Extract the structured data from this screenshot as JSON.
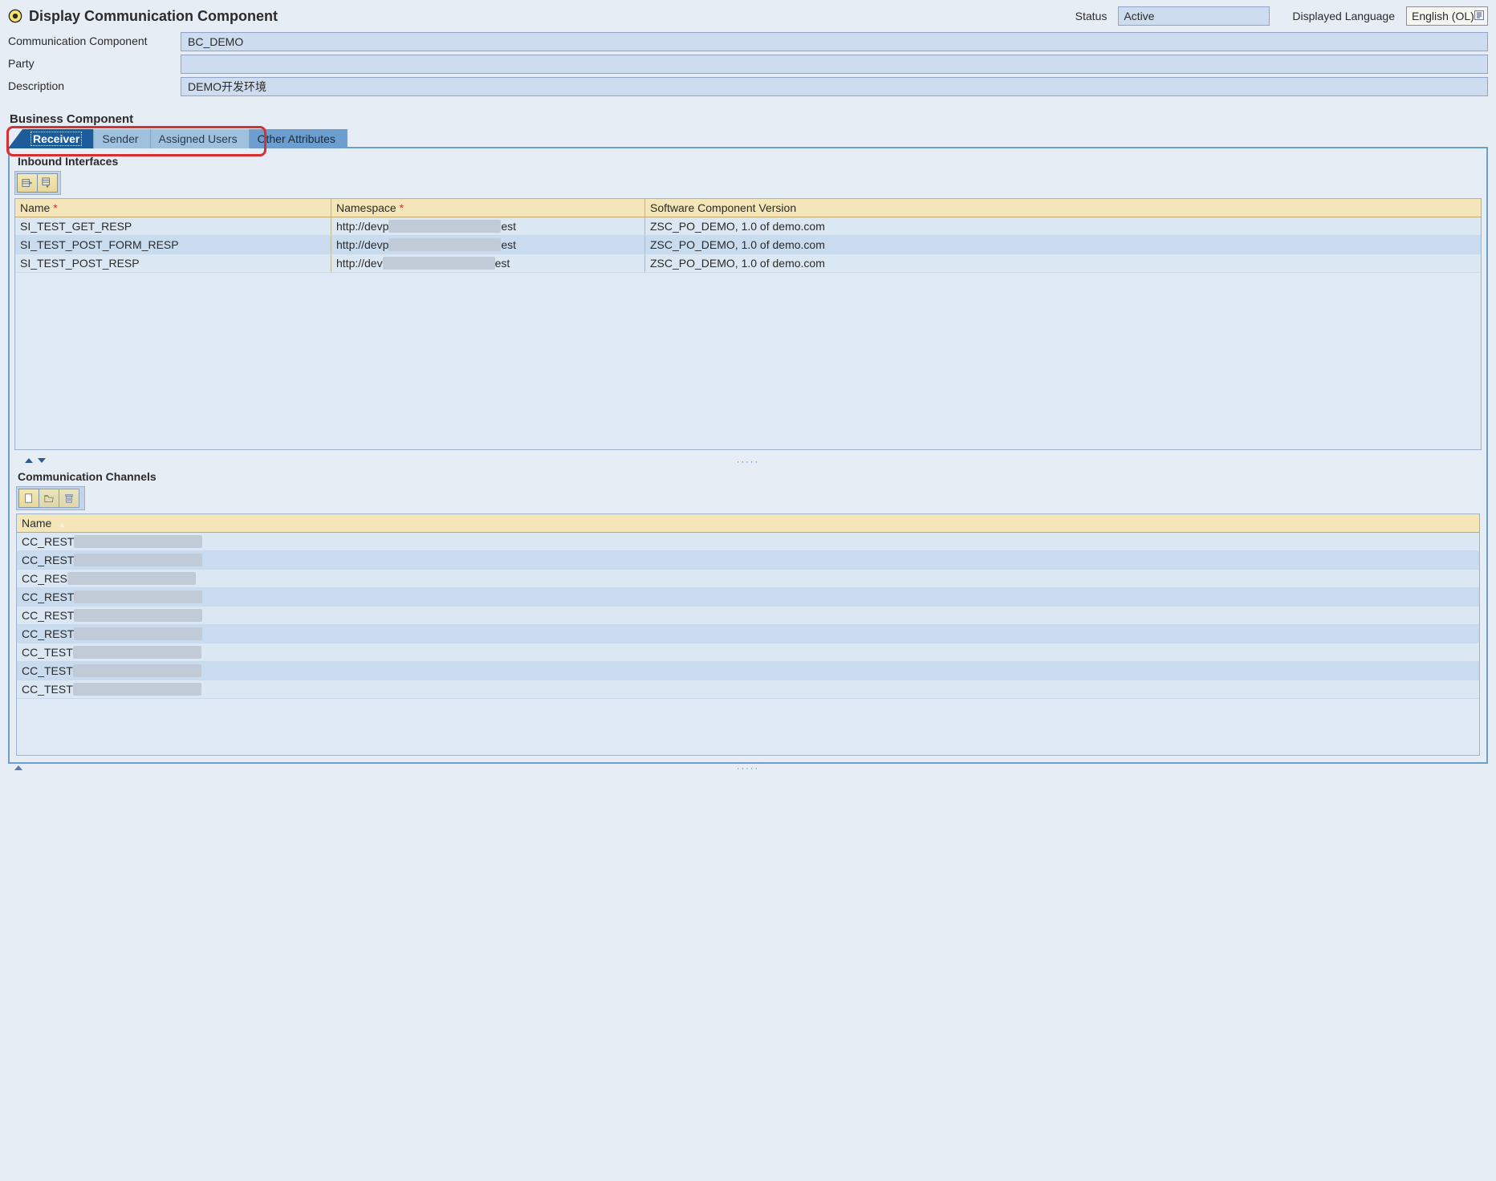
{
  "header": {
    "title": "Display Communication Component",
    "status_label": "Status",
    "status_value": "Active",
    "lang_label": "Displayed Language",
    "lang_value": "English (OL)"
  },
  "form": {
    "comm_comp_label": "Communication Component",
    "comm_comp_value": "BC_DEMO",
    "party_label": "Party",
    "party_value": "",
    "description_label": "Description",
    "description_value": "DEMO开发环境"
  },
  "section_heading": "Business Component",
  "tabs": {
    "receiver": "Receiver",
    "sender": "Sender",
    "assigned_users": "Assigned Users",
    "other_attributes": "Other Attributes"
  },
  "inbound": {
    "heading": "Inbound Interfaces",
    "col_name": "Name",
    "col_namespace": "Namespace",
    "col_scv": "Software Component Version",
    "rows": [
      {
        "name": "SI_TEST_GET_RESP",
        "ns_pre": "http://devp",
        "ns_suf": "est",
        "scv": "ZSC_PO_DEMO, 1.0 of demo.com"
      },
      {
        "name": "SI_TEST_POST_FORM_RESP",
        "ns_pre": "http://devp",
        "ns_suf": "est",
        "scv": "ZSC_PO_DEMO, 1.0 of demo.com"
      },
      {
        "name": "SI_TEST_POST_RESP",
        "ns_pre": "http://dev",
        "ns_suf": "est",
        "scv": "ZSC_PO_DEMO, 1.0 of demo.com"
      }
    ]
  },
  "channels": {
    "heading": "Communication Channels",
    "col_name": "Name",
    "rows": [
      {
        "name": "CC_REST"
      },
      {
        "name": "CC_REST"
      },
      {
        "name": "CC_RES"
      },
      {
        "name": "CC_REST"
      },
      {
        "name": "CC_REST"
      },
      {
        "name": "CC_REST"
      },
      {
        "name": "CC_TEST"
      },
      {
        "name": "CC_TEST"
      },
      {
        "name": "CC_TEST"
      }
    ]
  }
}
